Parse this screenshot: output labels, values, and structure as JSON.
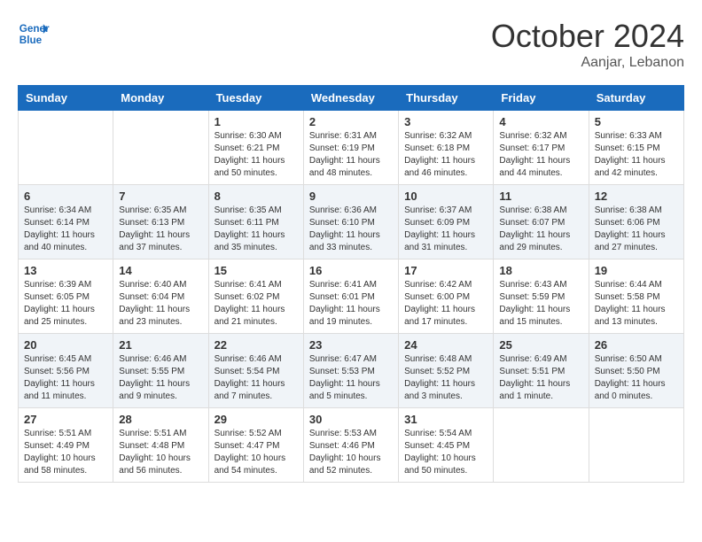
{
  "header": {
    "logo_line1": "General",
    "logo_line2": "Blue",
    "month": "October 2024",
    "location": "Aanjar, Lebanon"
  },
  "weekdays": [
    "Sunday",
    "Monday",
    "Tuesday",
    "Wednesday",
    "Thursday",
    "Friday",
    "Saturday"
  ],
  "weeks": [
    [
      null,
      null,
      {
        "day": 1,
        "sunrise": "6:30 AM",
        "sunset": "6:21 PM",
        "daylight": "11 hours and 50 minutes."
      },
      {
        "day": 2,
        "sunrise": "6:31 AM",
        "sunset": "6:19 PM",
        "daylight": "11 hours and 48 minutes."
      },
      {
        "day": 3,
        "sunrise": "6:32 AM",
        "sunset": "6:18 PM",
        "daylight": "11 hours and 46 minutes."
      },
      {
        "day": 4,
        "sunrise": "6:32 AM",
        "sunset": "6:17 PM",
        "daylight": "11 hours and 44 minutes."
      },
      {
        "day": 5,
        "sunrise": "6:33 AM",
        "sunset": "6:15 PM",
        "daylight": "11 hours and 42 minutes."
      }
    ],
    [
      {
        "day": 6,
        "sunrise": "6:34 AM",
        "sunset": "6:14 PM",
        "daylight": "11 hours and 40 minutes."
      },
      {
        "day": 7,
        "sunrise": "6:35 AM",
        "sunset": "6:13 PM",
        "daylight": "11 hours and 37 minutes."
      },
      {
        "day": 8,
        "sunrise": "6:35 AM",
        "sunset": "6:11 PM",
        "daylight": "11 hours and 35 minutes."
      },
      {
        "day": 9,
        "sunrise": "6:36 AM",
        "sunset": "6:10 PM",
        "daylight": "11 hours and 33 minutes."
      },
      {
        "day": 10,
        "sunrise": "6:37 AM",
        "sunset": "6:09 PM",
        "daylight": "11 hours and 31 minutes."
      },
      {
        "day": 11,
        "sunrise": "6:38 AM",
        "sunset": "6:07 PM",
        "daylight": "11 hours and 29 minutes."
      },
      {
        "day": 12,
        "sunrise": "6:38 AM",
        "sunset": "6:06 PM",
        "daylight": "11 hours and 27 minutes."
      }
    ],
    [
      {
        "day": 13,
        "sunrise": "6:39 AM",
        "sunset": "6:05 PM",
        "daylight": "11 hours and 25 minutes."
      },
      {
        "day": 14,
        "sunrise": "6:40 AM",
        "sunset": "6:04 PM",
        "daylight": "11 hours and 23 minutes."
      },
      {
        "day": 15,
        "sunrise": "6:41 AM",
        "sunset": "6:02 PM",
        "daylight": "11 hours and 21 minutes."
      },
      {
        "day": 16,
        "sunrise": "6:41 AM",
        "sunset": "6:01 PM",
        "daylight": "11 hours and 19 minutes."
      },
      {
        "day": 17,
        "sunrise": "6:42 AM",
        "sunset": "6:00 PM",
        "daylight": "11 hours and 17 minutes."
      },
      {
        "day": 18,
        "sunrise": "6:43 AM",
        "sunset": "5:59 PM",
        "daylight": "11 hours and 15 minutes."
      },
      {
        "day": 19,
        "sunrise": "6:44 AM",
        "sunset": "5:58 PM",
        "daylight": "11 hours and 13 minutes."
      }
    ],
    [
      {
        "day": 20,
        "sunrise": "6:45 AM",
        "sunset": "5:56 PM",
        "daylight": "11 hours and 11 minutes."
      },
      {
        "day": 21,
        "sunrise": "6:46 AM",
        "sunset": "5:55 PM",
        "daylight": "11 hours and 9 minutes."
      },
      {
        "day": 22,
        "sunrise": "6:46 AM",
        "sunset": "5:54 PM",
        "daylight": "11 hours and 7 minutes."
      },
      {
        "day": 23,
        "sunrise": "6:47 AM",
        "sunset": "5:53 PM",
        "daylight": "11 hours and 5 minutes."
      },
      {
        "day": 24,
        "sunrise": "6:48 AM",
        "sunset": "5:52 PM",
        "daylight": "11 hours and 3 minutes."
      },
      {
        "day": 25,
        "sunrise": "6:49 AM",
        "sunset": "5:51 PM",
        "daylight": "11 hours and 1 minute."
      },
      {
        "day": 26,
        "sunrise": "6:50 AM",
        "sunset": "5:50 PM",
        "daylight": "11 hours and 0 minutes."
      }
    ],
    [
      {
        "day": 27,
        "sunrise": "5:51 AM",
        "sunset": "4:49 PM",
        "daylight": "10 hours and 58 minutes."
      },
      {
        "day": 28,
        "sunrise": "5:51 AM",
        "sunset": "4:48 PM",
        "daylight": "10 hours and 56 minutes."
      },
      {
        "day": 29,
        "sunrise": "5:52 AM",
        "sunset": "4:47 PM",
        "daylight": "10 hours and 54 minutes."
      },
      {
        "day": 30,
        "sunrise": "5:53 AM",
        "sunset": "4:46 PM",
        "daylight": "10 hours and 52 minutes."
      },
      {
        "day": 31,
        "sunrise": "5:54 AM",
        "sunset": "4:45 PM",
        "daylight": "10 hours and 50 minutes."
      },
      null,
      null
    ]
  ]
}
